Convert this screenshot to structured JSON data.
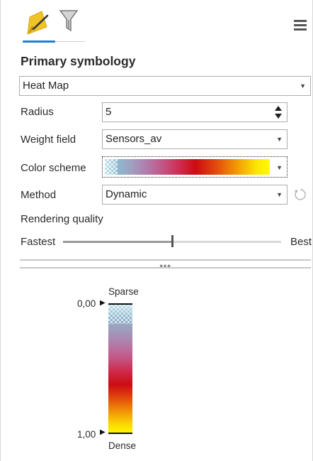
{
  "tabs": {
    "primary_icon": "paint-brush-icon",
    "secondary_icon": "filter-icon"
  },
  "menu_icon": "hamburger-menu-icon",
  "section_title": "Primary symbology",
  "symbology_type": "Heat Map",
  "fields": {
    "radius": {
      "label": "Radius",
      "value": "5"
    },
    "weight_field": {
      "label": "Weight field",
      "value": "Sensors_av"
    },
    "color_scheme": {
      "label": "Color scheme",
      "colors": [
        "#bfe4ee",
        "#b07dac",
        "#cc0c12",
        "#f39a06",
        "#fffb00"
      ]
    },
    "method": {
      "label": "Method",
      "value": "Dynamic",
      "reset_icon": "refresh-icon"
    }
  },
  "rendering_quality": {
    "label": "Rendering quality",
    "min_label": "Fastest",
    "max_label": "Best",
    "value_fraction": 0.5
  },
  "legend": {
    "top_label": "Sparse",
    "bottom_label": "Dense",
    "top_value": "0,00",
    "bottom_value": "1,00"
  }
}
